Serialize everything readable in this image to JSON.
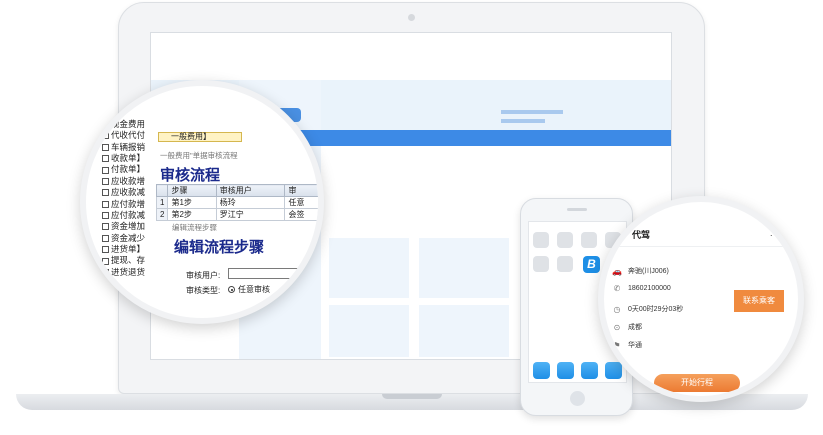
{
  "left_zoom": {
    "list_items": [
      "收入】",
      "一般费用】",
      "现金费用",
      "代收代付",
      "车辆报销",
      "收款单】",
      "付款单】",
      "应收款增",
      "应收款减",
      "应付款增",
      "应付款减",
      "资金增加",
      "资金减少",
      "进货单】",
      "提现、存",
      "进货退货"
    ],
    "highlight_item": "一般费用】",
    "caption": "一般费用\"单据审核流程",
    "title": "审核流程",
    "table": {
      "headers": [
        "",
        "步骤",
        "审核用户",
        "审"
      ],
      "rows": [
        [
          "1",
          "第1步",
          "杨玲",
          "任意"
        ],
        [
          "2",
          "第2步",
          "罗江宁",
          "会签"
        ]
      ]
    },
    "dialog_caption": "编辑流程步骤",
    "dialog_title": "编辑流程步骤",
    "field_user_label": "审核用户:",
    "field_type_label": "审核类型:",
    "radio_selected": "任意审核"
  },
  "phone": {
    "app_logo": "B"
  },
  "right_zoom": {
    "title": "代驾",
    "menu_dot": ".",
    "car": "奔驰(川J006)",
    "phone_number": "18602100000",
    "duration": "0天00时29分03秒",
    "from": "成都",
    "to": "华通",
    "contact_button": "联系乘客",
    "start_button": "开始行程"
  }
}
